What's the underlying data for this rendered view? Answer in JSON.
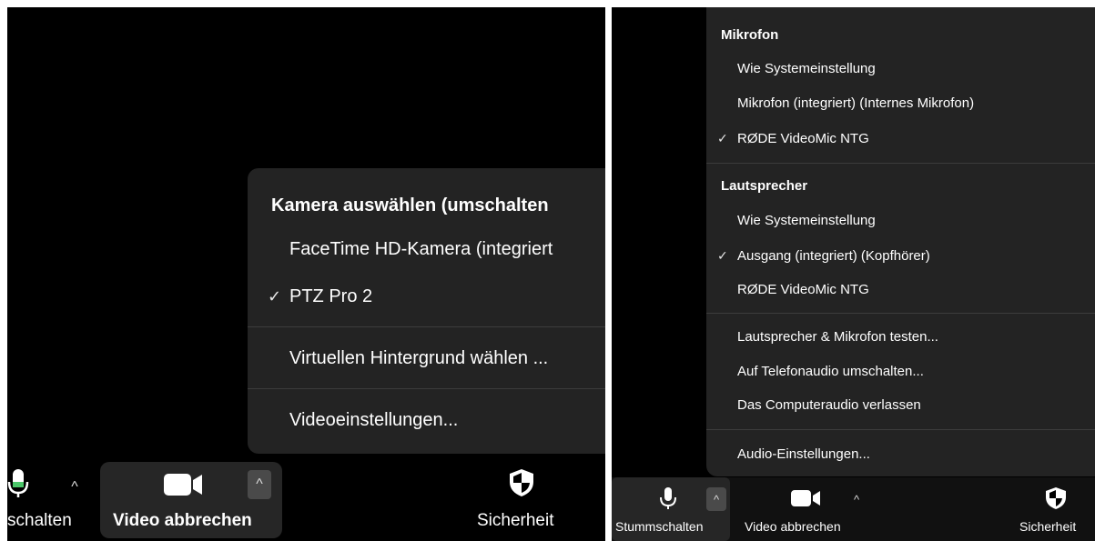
{
  "left": {
    "menu": {
      "header": "Kamera auswählen (umschalten",
      "items": [
        {
          "label": "FaceTime HD-Kamera (integriert",
          "checked": false
        },
        {
          "label": "PTZ Pro 2",
          "checked": true
        }
      ],
      "virtual_bg": "Virtuellen Hintergrund wählen ...",
      "video_settings": "Videoeinstellungen..."
    },
    "toolbar": {
      "mute_label": "schalten",
      "video_label": "Video abbrechen",
      "security_label": "Sicherheit"
    }
  },
  "right": {
    "menu": {
      "mic_header": "Mikrofon",
      "mic_items": [
        {
          "label": "Wie Systemeinstellung",
          "checked": false
        },
        {
          "label": "Mikrofon (integriert) (Internes Mikrofon)",
          "checked": false
        },
        {
          "label": "RØDE VideoMic NTG",
          "checked": true
        }
      ],
      "speaker_header": "Lautsprecher",
      "speaker_items": [
        {
          "label": "Wie Systemeinstellung",
          "checked": false
        },
        {
          "label": "Ausgang (integriert) (Kopfhörer)",
          "checked": true
        },
        {
          "label": "RØDE VideoMic NTG",
          "checked": false
        }
      ],
      "actions": [
        "Lautsprecher & Mikrofon testen...",
        "Auf Telefonaudio umschalten...",
        "Das Computeraudio verlassen"
      ],
      "audio_settings": "Audio-Einstellungen..."
    },
    "toolbar": {
      "mute_label": "Stummschalten",
      "video_label": "Video abbrechen",
      "security_label": "Sicherheit"
    }
  },
  "icons": {
    "check": "✓",
    "chevron_up": "^"
  },
  "colors": {
    "background": "#000000",
    "menu": "#232323",
    "mic_active": "#4cc76a"
  }
}
